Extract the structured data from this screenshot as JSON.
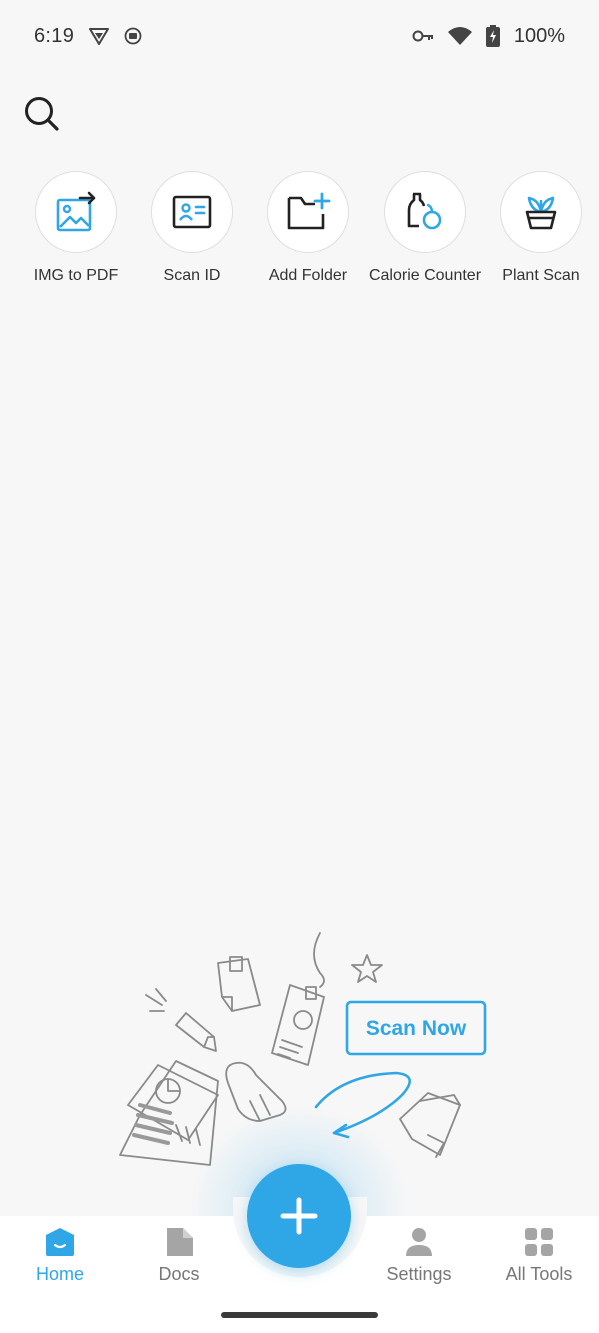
{
  "status_bar": {
    "time": "6:19",
    "battery": "100%",
    "left_icons": [
      "vpn-shield-icon",
      "screen-record-icon"
    ],
    "right_icons": [
      "key-icon",
      "wifi-icon",
      "battery-charging-icon"
    ]
  },
  "search": {
    "icon": "search-icon"
  },
  "quick_tools": [
    {
      "label": "IMG to PDF",
      "icon": "image-export-icon"
    },
    {
      "label": "Scan ID",
      "icon": "id-card-icon"
    },
    {
      "label": "Add Folder",
      "icon": "add-folder-icon"
    },
    {
      "label": "Calorie Counter",
      "icon": "calorie-icon"
    },
    {
      "label": "Plant Scan",
      "icon": "plant-icon"
    }
  ],
  "illustration": {
    "cta_text": "Scan Now"
  },
  "bottom_nav": {
    "items": [
      {
        "label": "Home",
        "icon": "home-icon",
        "active": true
      },
      {
        "label": "Docs",
        "icon": "document-icon",
        "active": false
      },
      {
        "label": "Settings",
        "icon": "person-icon",
        "active": false
      },
      {
        "label": "All Tools",
        "icon": "grid-icon",
        "active": false
      }
    ],
    "fab_icon": "plus-icon"
  },
  "colors": {
    "accent": "#2fa6e6",
    "background": "#f7f7f7",
    "nav_inactive": "#777777",
    "icon_dark": "#333333"
  }
}
